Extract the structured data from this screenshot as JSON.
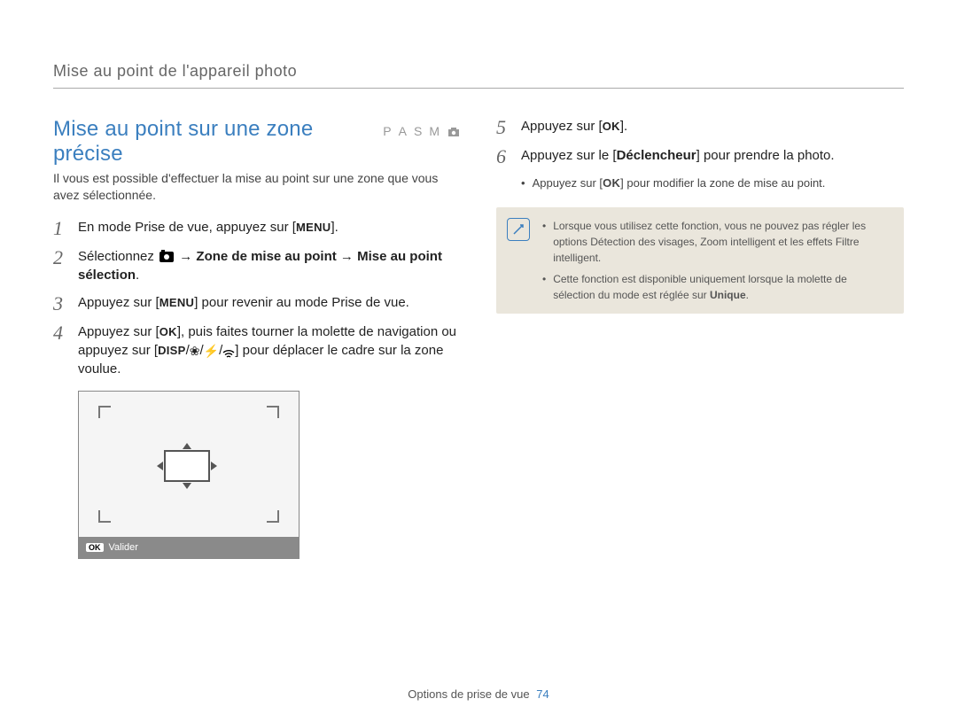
{
  "header": "Mise au point de l'appareil photo",
  "section_title": "Mise au point sur une zone précise",
  "modes": [
    "P",
    "A",
    "S",
    "M"
  ],
  "intro": "Il vous est possible d'effectuer la mise au point sur une zone que vous avez sélectionnée.",
  "steps_left": {
    "s1": {
      "n": "1",
      "pre": "En mode Prise de vue, appuyez sur [",
      "key": "MENU",
      "post": "]."
    },
    "s2": {
      "n": "2",
      "pre": "Sélectionnez ",
      "arrow1": " → ",
      "b1": "Zone de mise au point",
      "arrow2": " → ",
      "b2": "Mise au point sélection",
      "post": "."
    },
    "s3": {
      "n": "3",
      "pre": "Appuyez sur [",
      "key": "MENU",
      "post": "] pour revenir au mode Prise de vue."
    },
    "s4": {
      "n": "4",
      "pre": "Appuyez sur [",
      "key": "OK",
      "mid": "], puis faites tourner la molette de navigation ou appuyez sur [",
      "key2": "DISP",
      "slash": "/",
      "post2": "] pour déplacer le cadre sur la zone voulue."
    }
  },
  "preview_label": "Valider",
  "steps_right": {
    "s5": {
      "n": "5",
      "pre": "Appuyez sur [",
      "key": "OK",
      "post": "]."
    },
    "s6": {
      "n": "6",
      "pre": "Appuyez sur le [",
      "b": "Déclencheur",
      "post": "] pour prendre la photo."
    },
    "sub": {
      "pre": "Appuyez sur [",
      "key": "OK",
      "post": "] pour modifier la zone de mise au point."
    }
  },
  "note": {
    "b1_a": "Lorsque vous utilisez cette fonction, vous ne pouvez pas régler les options Détection des visages, Zoom intelligent et les effets Filtre intelligent.",
    "b2_a": "Cette fonction est disponible uniquement lorsque la molette de sélection du mode est réglée sur ",
    "b2_bold": "Unique",
    "b2_b": "."
  },
  "footer": {
    "label": "Options de prise de vue",
    "page": "74"
  }
}
